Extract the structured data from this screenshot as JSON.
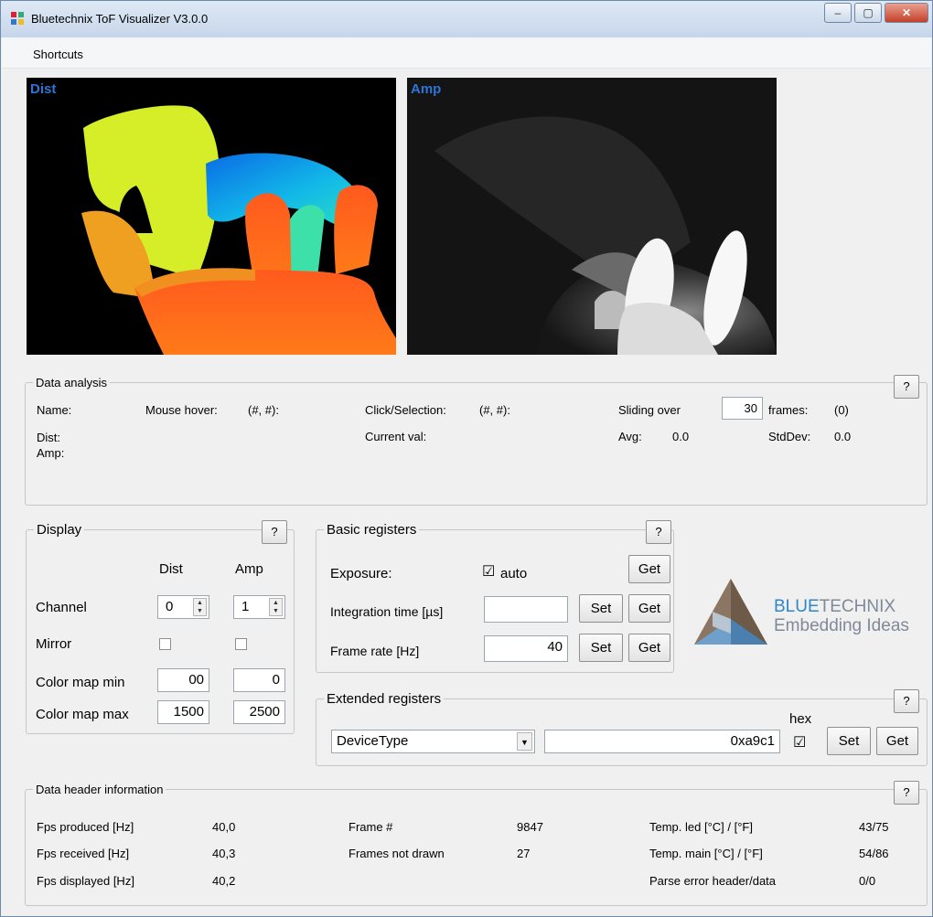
{
  "window": {
    "title": "Bluetechnix ToF Visualizer V3.0.0",
    "minimize": "–",
    "maximize": "▢",
    "close": "✕"
  },
  "menu": {
    "shortcuts": "Shortcuts"
  },
  "images": {
    "dist_label": "Dist",
    "amp_label": "Amp"
  },
  "data_analysis": {
    "title": "Data analysis",
    "help": "?",
    "name": "Name:",
    "mouse_hover": "Mouse hover:",
    "mouse_hover_val": "(#, #):",
    "click_selection": "Click/Selection:",
    "click_selection_val": "(#, #):",
    "sliding_over": "Sliding over",
    "sliding_value": "30",
    "frames": "frames:",
    "frames_count": "(0)",
    "dist": "Dist:",
    "amp": "Amp:",
    "current_val": "Current val:",
    "avg_label": "Avg:",
    "avg_value": "0.0",
    "stddev_label": "StdDev:",
    "stddev_value": "0.0"
  },
  "display": {
    "title": "Display",
    "help": "?",
    "dist_header": "Dist",
    "amp_header": "Amp",
    "channel": "Channel",
    "channel_dist": "0",
    "channel_amp": "1",
    "mirror": "Mirror",
    "color_map_min": "Color map min",
    "color_map_min_dist": "00",
    "color_map_min_amp": "0",
    "color_map_max": "Color map max",
    "color_map_max_dist": "1500",
    "color_map_max_amp": "2500"
  },
  "basic_registers": {
    "title": "Basic registers",
    "help": "?",
    "exposure": "Exposure:",
    "auto": "auto",
    "auto_checked": "☑",
    "integration_time": "Integration time [µs]",
    "integration_value": "",
    "frame_rate": "Frame rate [Hz]",
    "frame_rate_value": "40",
    "set": "Set",
    "get": "Get"
  },
  "logo": {
    "blue": "BLUE",
    "technix": "TECHNIX",
    "tagline": "Embedding Ideas"
  },
  "extended_registers": {
    "title": "Extended registers",
    "help": "?",
    "hex": "hex",
    "hex_checked": "☑",
    "register": "DeviceType",
    "value": "0xa9c1",
    "set": "Set",
    "get": "Get"
  },
  "data_header": {
    "title": "Data header information",
    "help": "?",
    "fps_produced": "Fps produced [Hz]",
    "fps_produced_val": "40,0",
    "fps_received": "Fps received [Hz]",
    "fps_received_val": "40,3",
    "fps_displayed": "Fps displayed [Hz]",
    "fps_displayed_val": "40,2",
    "frame_no": "Frame #",
    "frame_no_val": "9847",
    "frames_not_drawn": "Frames not drawn",
    "frames_not_drawn_val": "27",
    "temp_led": "Temp. led [°C] / [°F]",
    "temp_led_val": "43/75",
    "temp_main": "Temp. main [°C] / [°F]",
    "temp_main_val": "54/86",
    "parse_error": "Parse error header/data",
    "parse_error_val": "0/0"
  },
  "colors": {
    "label_blue": "#2c74d6",
    "brand_blue": "#2e86c7",
    "brand_gray": "#7f8a98"
  }
}
